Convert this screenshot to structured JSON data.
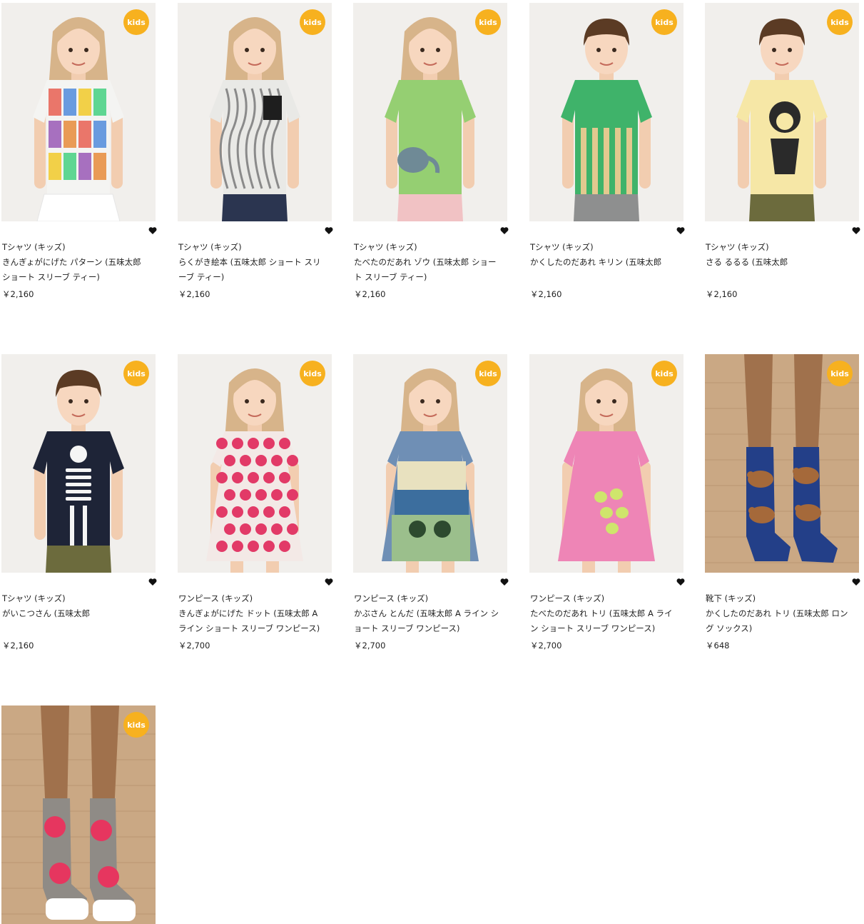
{
  "badge_label": "kids",
  "colors": {
    "badge": "#f7b11f",
    "text": "#222222",
    "wall": "#f1efec",
    "floor": "#caa884"
  },
  "products": [
    {
      "category": "Tシャツ (キッズ)",
      "title": "きんぎょがにげた パターン (五味太郎 ショート スリーブ ティー)",
      "price": "￥2,160",
      "shirt": "#f4f4f2",
      "print": "patchwork",
      "bottom": "#ffffff",
      "hair": "#d7b48a",
      "model": "girl"
    },
    {
      "category": "Tシャツ (キッズ)",
      "title": "らくがき絵本 (五味太郎 ショート スリーブ ティー)",
      "price": "￥2,160",
      "shirt": "#e9e9e6",
      "print": "scribble",
      "bottom": "#2b3550",
      "hair": "#d7b48a",
      "model": "girl"
    },
    {
      "category": "Tシャツ (キッズ)",
      "title": "たべたのだあれ ゾウ (五味太郎 ショート スリーブ ティー)",
      "price": "￥2,160",
      "shirt": "#95cf72",
      "print": "elephant",
      "bottom": "#f1c2c4",
      "hair": "#d7b48a",
      "model": "girl"
    },
    {
      "category": "Tシャツ (キッズ)",
      "title": "かくしたのだあれ キリン (五味太郎",
      "price": "￥2,160",
      "shirt": "#3fb36a",
      "print": "giraffe",
      "bottom": "#8e8f8f",
      "hair": "#5b3b24",
      "model": "boy"
    },
    {
      "category": "Tシャツ (キッズ)",
      "title": "さる るるる (五味太郎",
      "price": "￥2,160",
      "shirt": "#f6e7a6",
      "print": "monkey",
      "bottom": "#6c6b3d",
      "hair": "#5b3b24",
      "model": "boy"
    },
    {
      "category": "Tシャツ (キッズ)",
      "title": "がいこつさん (五味太郎",
      "price": "￥2,160",
      "shirt": "#1e2437",
      "print": "skeleton",
      "bottom": "#6c6b3d",
      "hair": "#5b3b24",
      "model": "boy"
    },
    {
      "category": "ワンピース (キッズ)",
      "title": "きんぎょがにげた ドット (五味太郎 A ライン ショート スリーブ ワンピース)",
      "price": "￥2,700",
      "shirt": "#f3e9e6",
      "print": "dots",
      "bottom": "dress",
      "hair": "#d7b48a",
      "model": "girl"
    },
    {
      "category": "ワンピース (キッズ)",
      "title": "かぶさん とんだ (五味太郎 A ライン ショート スリーブ ワンピース)",
      "price": "￥2,700",
      "shirt": "#6f8fb5",
      "print": "landscape",
      "bottom": "dress",
      "hair": "#d7b48a",
      "model": "girl"
    },
    {
      "category": "ワンピース (キッズ)",
      "title": "たべたのだあれ トリ (五味太郎 A ライン ショート スリーブ ワンピース)",
      "price": "￥2,700",
      "shirt": "#ee85b6",
      "print": "birds",
      "bottom": "dress",
      "hair": "#d7b48a",
      "model": "girl"
    },
    {
      "category": "靴下 (キッズ)",
      "title": "かくしたのだあれ トリ (五味太郎 ロング ソックス)",
      "price": "￥648",
      "shirt": "#233f88",
      "print": "socks-birds",
      "bottom": "legs",
      "hair": "",
      "model": "socks"
    },
    {
      "category": "",
      "title": "",
      "price": "",
      "shirt": "#8f8b86",
      "print": "socks-dots",
      "bottom": "legs",
      "hair": "",
      "model": "socks"
    }
  ]
}
